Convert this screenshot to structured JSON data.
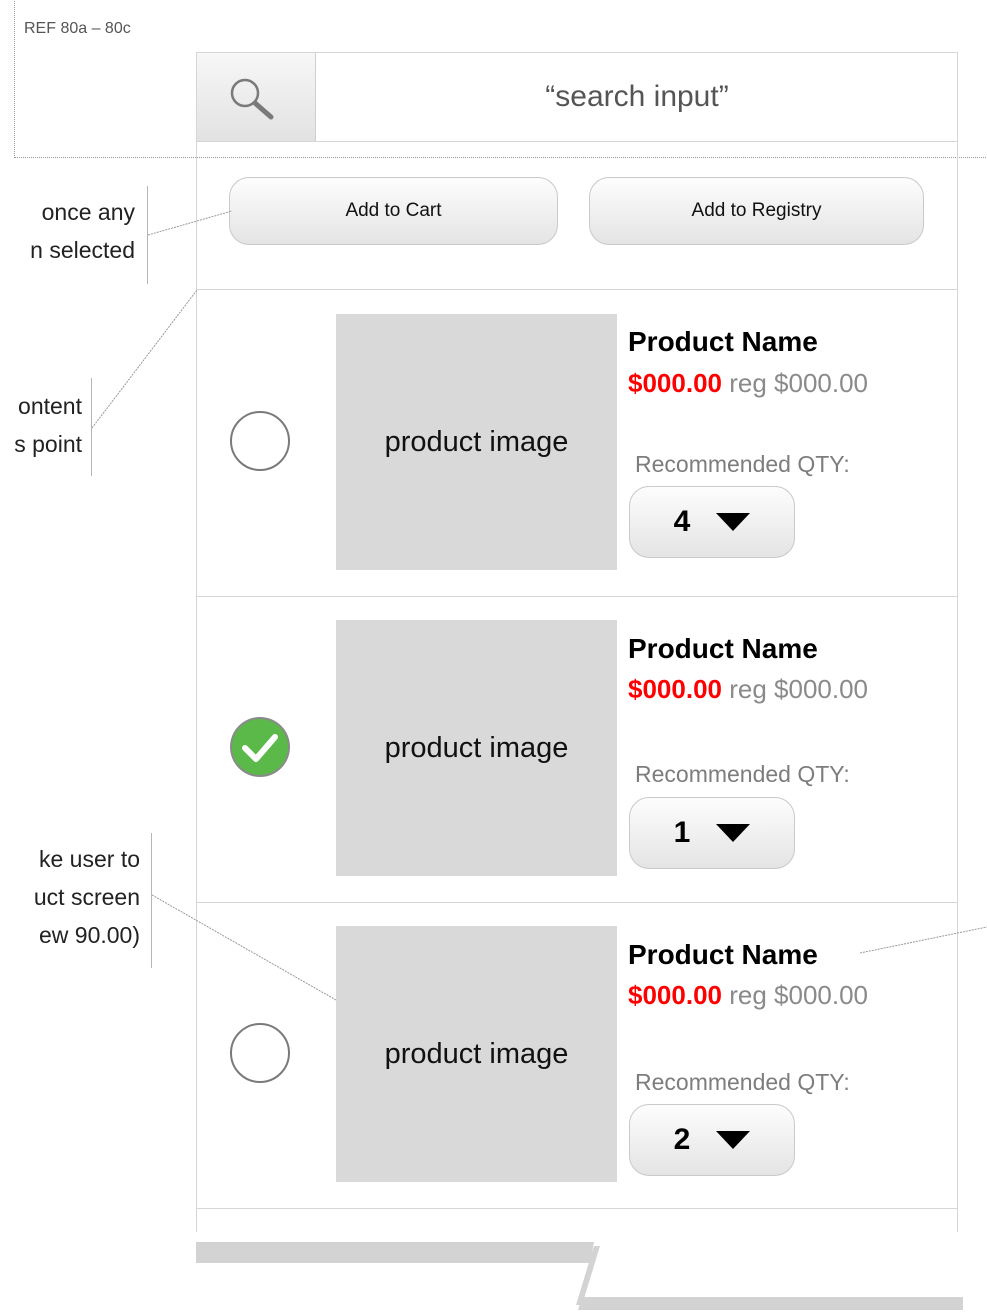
{
  "reference": {
    "label": "REF 80a – 80c"
  },
  "search": {
    "placeholder_text": "“search input”",
    "icon": "search-icon"
  },
  "actions": {
    "add_to_cart": "Add to Cart",
    "add_to_registry": "Add to Registry"
  },
  "annotations": {
    "note1": [
      "once any",
      "n selected"
    ],
    "note2": [
      "ontent",
      "s point"
    ],
    "note3": [
      "ke user to",
      "uct screen",
      "ew 90.00)"
    ]
  },
  "products": [
    {
      "image_label": "product image",
      "name": "Product Name",
      "sale_price": "$000.00",
      "reg_price": "reg $000.00",
      "rec_label": "Recommended QTY:",
      "qty": "4",
      "selected": false
    },
    {
      "image_label": "product image",
      "name": "Product Name",
      "sale_price": "$000.00",
      "reg_price": "reg $000.00",
      "rec_label": "Recommended QTY:",
      "qty": "1",
      "selected": true
    },
    {
      "image_label": "product image",
      "name": "Product Name",
      "sale_price": "$000.00",
      "reg_price": "reg $000.00",
      "rec_label": "Recommended QTY:",
      "qty": "2",
      "selected": false
    }
  ],
  "colors": {
    "sale": "#ff0000",
    "check_green": "#5bb94a",
    "image_placeholder": "#d9d9d9"
  }
}
